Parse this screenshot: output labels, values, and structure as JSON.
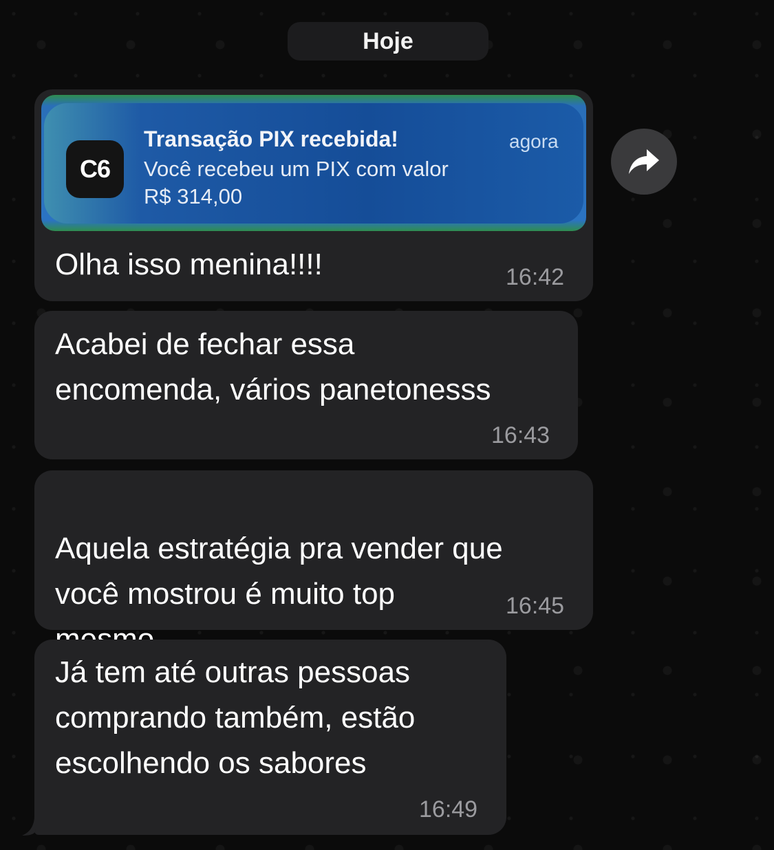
{
  "date_separator": "Hoje",
  "notification": {
    "app_icon_text": "C6",
    "title": "Transação PIX recebida!",
    "time": "agora",
    "body": "Você recebeu um PIX com valor\nR$ 314,00"
  },
  "messages": [
    {
      "text": "Olha isso menina!!!!",
      "time": "16:42"
    },
    {
      "text": "Acabei de fechar essa\nencomenda, vários panetonesss",
      "time": "16:43"
    },
    {
      "text": "Aquela estratégia pra vender que\nvocê mostrou é muito top\nmesmo",
      "emoji": "😊",
      "time": "16:45"
    },
    {
      "text": "Já tem até outras pessoas\ncomprando também, estão\nescolhendo os sabores",
      "time": "16:49"
    }
  ],
  "forward_icon": "forward-arrow-icon",
  "colors": {
    "bubble": "#232325",
    "background": "#0b0b0b",
    "timestamp": "#9b9b9f",
    "notification_blue": "#1e5aa6"
  }
}
